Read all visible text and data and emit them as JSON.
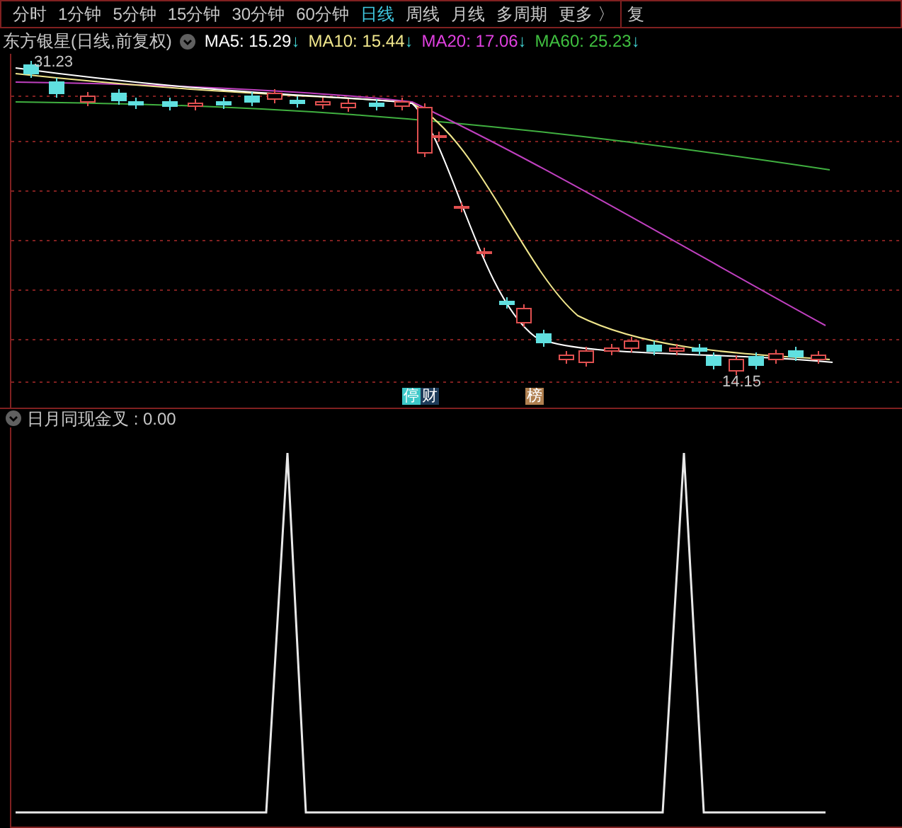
{
  "toolbar": {
    "tabs": [
      {
        "label": "分时",
        "selected": false
      },
      {
        "label": "1分钟",
        "selected": false
      },
      {
        "label": "5分钟",
        "selected": false
      },
      {
        "label": "15分钟",
        "selected": false
      },
      {
        "label": "30分钟",
        "selected": false
      },
      {
        "label": "60分钟",
        "selected": false
      },
      {
        "label": "日线",
        "selected": true
      },
      {
        "label": "周线",
        "selected": false
      },
      {
        "label": "月线",
        "selected": false
      },
      {
        "label": "多周期",
        "selected": false
      },
      {
        "label": "更多 〉",
        "selected": false
      }
    ],
    "side_button": "复"
  },
  "main_chart": {
    "title": "东方银星(日线,前复权)",
    "indicators": [
      {
        "label": "MA5: 15.29",
        "arrow": "↓",
        "color": "#ffffff"
      },
      {
        "label": "MA10: 15.44",
        "arrow": "↓",
        "color": "#f0e68c"
      },
      {
        "label": "MA20: 17.06",
        "arrow": "↓",
        "color": "#e040e0"
      },
      {
        "label": "MA60: 25.23",
        "arrow": "↓",
        "color": "#40c040"
      }
    ],
    "high_label": "31.23",
    "low_label": "14.15",
    "badges": [
      {
        "text": "停",
        "color": "#3cc8c8"
      },
      {
        "text": "财",
        "color": "#1e3c5a"
      },
      {
        "text": "榜",
        "color": "#b08050"
      }
    ]
  },
  "sub_chart": {
    "title": "日月同现金叉 : 0.00"
  }
}
